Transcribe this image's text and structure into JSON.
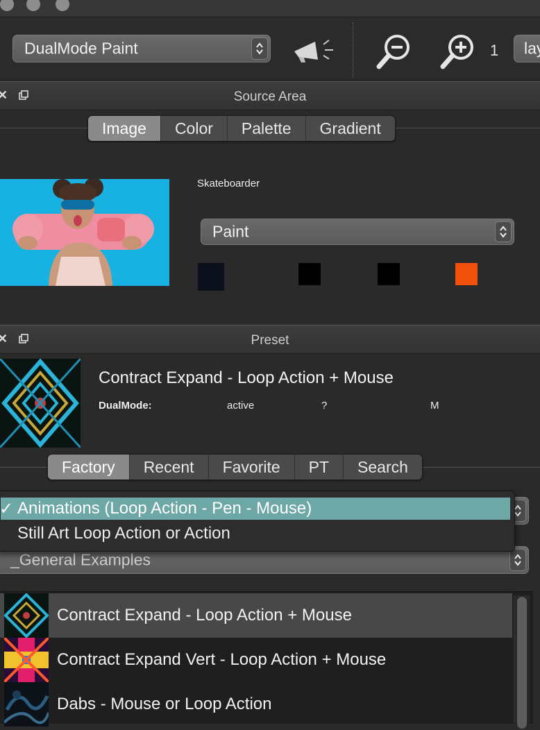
{
  "toolbar": {
    "brush_mode": "DualMode Paint",
    "zoom_value": "1",
    "layer_field": "lay"
  },
  "source_area": {
    "title": "Source Area",
    "tabs": [
      "Image",
      "Color",
      "Palette",
      "Gradient"
    ],
    "selected_tab": "Image",
    "image_name": "Skateboarder",
    "mode": "Paint",
    "swatches": [
      "#0a111c",
      "#000000",
      "#000000",
      "#f0520e"
    ]
  },
  "preset": {
    "title": "Preset",
    "name": "Contract Expand - Loop Action + Mouse",
    "dualmode_label": "DualMode:",
    "dualmode_status": "active",
    "help": "?",
    "mode_letter": "M",
    "tabs": [
      "Factory",
      "Recent",
      "Favorite",
      "PT",
      "Search"
    ],
    "selected_tab": "Factory",
    "category_menu": {
      "checkmark": "✓",
      "options": [
        "Animations (Loop Action - Pen - Mouse)",
        "Still Art Loop Action or Action"
      ],
      "selected": "Animations (Loop Action - Pen - Mouse)"
    },
    "group_select": "_General Examples",
    "items": [
      "Contract Expand - Loop Action + Mouse",
      "Contract Expand Vert - Loop Action + Mouse",
      "Dabs - Mouse or Loop Action"
    ],
    "selected_item": "Contract Expand - Loop Action + Mouse"
  },
  "icons": {
    "close": "close-icon",
    "detach": "detach-icon",
    "stepper": "updown-chevron-icon",
    "megaphone": "megaphone-icon",
    "zoom_out": "zoom-out-icon",
    "zoom_in": "zoom-in-icon"
  }
}
